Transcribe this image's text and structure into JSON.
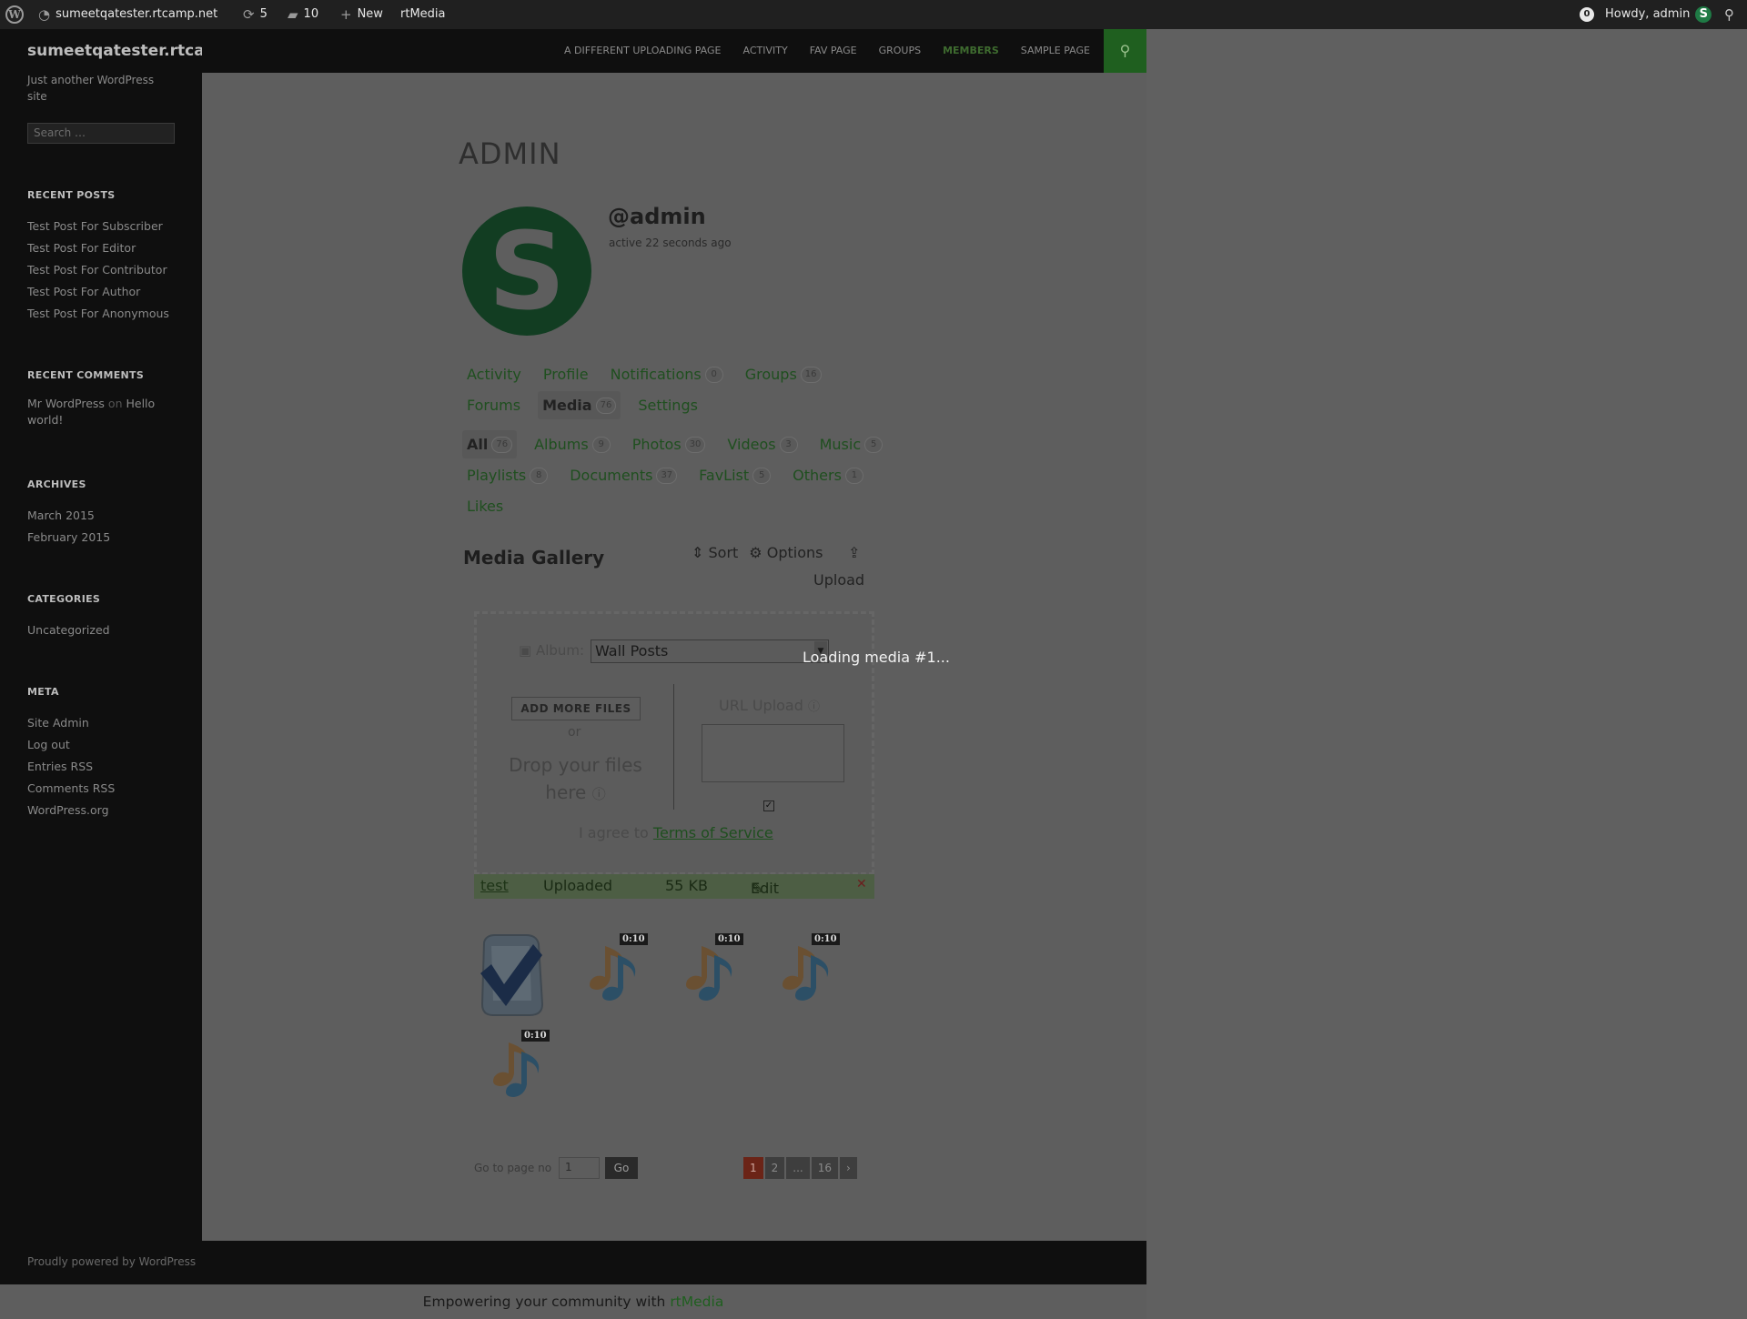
{
  "admin_bar": {
    "site_name": "sumeetqatester.rtcamp.net",
    "updates_count": "5",
    "comments_count": "10",
    "new_label": "New",
    "plugin_label": "rtMedia",
    "notifications_count": "0",
    "howdy": "Howdy, admin"
  },
  "sidebar": {
    "site_title": "sumeetqatester.rtcamp.net",
    "tagline": "Just another WordPress site",
    "search_placeholder": "Search …",
    "recent_posts_heading": "RECENT POSTS",
    "recent_posts": [
      "Test Post For Subscriber",
      "Test Post For Editor",
      "Test Post For Contributor",
      "Test Post For Author",
      "Test Post For Anonymous"
    ],
    "recent_comments_heading": "RECENT COMMENTS",
    "recent_comment": {
      "author": "Mr WordPress",
      "on": "on",
      "post": "Hello world!"
    },
    "archives_heading": "ARCHIVES",
    "archives": [
      "March 2015",
      "February 2015"
    ],
    "categories_heading": "CATEGORIES",
    "categories": [
      "Uncategorized"
    ],
    "meta_heading": "META",
    "meta": [
      "Site Admin",
      "Log out",
      "Entries RSS",
      "Comments RSS",
      "WordPress.org"
    ]
  },
  "nav": {
    "items": [
      "A DIFFERENT UPLOADING PAGE",
      "ACTIVITY",
      "FAV PAGE",
      "GROUPS",
      "MEMBERS",
      "SAMPLE PAGE"
    ],
    "active": "MEMBERS"
  },
  "profile": {
    "page_title": "ADMIN",
    "avatar_letter": "S",
    "username": "@admin",
    "activity": "active 22 seconds ago",
    "tabs": [
      {
        "label": "Activity"
      },
      {
        "label": "Profile"
      },
      {
        "label": "Notifications",
        "count": "0"
      },
      {
        "label": "Groups",
        "count": "16"
      },
      {
        "label": "Forums"
      },
      {
        "label": "Media",
        "count": "76",
        "selected": true
      },
      {
        "label": "Settings"
      }
    ],
    "media_tabs": [
      {
        "label": "All",
        "count": "76",
        "selected": true
      },
      {
        "label": "Albums",
        "count": "9"
      },
      {
        "label": "Photos",
        "count": "30"
      },
      {
        "label": "Videos",
        "count": "3"
      },
      {
        "label": "Music",
        "count": "5"
      },
      {
        "label": "Playlists",
        "count": "8"
      },
      {
        "label": "Documents",
        "count": "37"
      },
      {
        "label": "FavList",
        "count": "5"
      },
      {
        "label": "Others",
        "count": "1"
      },
      {
        "label": "Likes"
      }
    ]
  },
  "gallery": {
    "title": "Media Gallery",
    "sort_label": "Sort",
    "options_label": "Options",
    "upload_label": "Upload"
  },
  "uploader": {
    "album_label": "Album:",
    "album_value": "Wall Posts",
    "add_files": "ADD MORE FILES",
    "or": "or",
    "drop_text": "Drop your files here",
    "url_label": "URL Upload",
    "agree_text": "I agree to",
    "tos": "Terms of Service",
    "loading": "Loading media #1..."
  },
  "uploaded_file": {
    "name": "test",
    "status": "Uploaded",
    "size": "55 KB",
    "edit": "Edit",
    "close": "✕"
  },
  "media_items": [
    {
      "type": "document",
      "icon": "checkmark-document-icon"
    },
    {
      "type": "music",
      "icon": "music-note-icon",
      "duration": "0:10"
    },
    {
      "type": "music",
      "icon": "music-note-icon",
      "duration": "0:10"
    },
    {
      "type": "music",
      "icon": "music-note-icon",
      "duration": "0:10"
    },
    {
      "type": "music",
      "icon": "music-note-icon",
      "duration": "0:10"
    }
  ],
  "pagination": {
    "goto_label": "Go to page no",
    "page_value": "1",
    "go_label": "Go",
    "pages": [
      "1",
      "2",
      "...",
      "16",
      "›"
    ],
    "current": "1"
  },
  "footer": {
    "powered": "Proudly powered by WordPress",
    "tagline_prefix": "Empowering your community with",
    "tagline_brand": "rtMedia"
  }
}
